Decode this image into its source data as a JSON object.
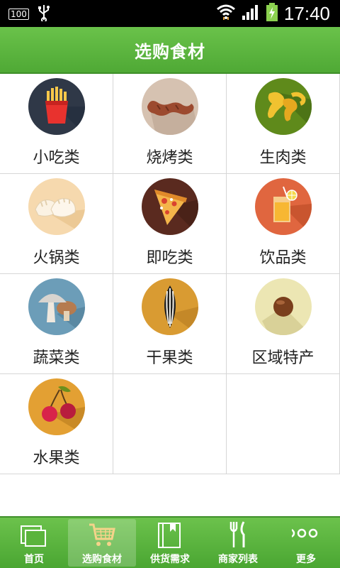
{
  "status_bar": {
    "battery_percent": "100",
    "time": "17:40"
  },
  "header": {
    "title": "选购食材"
  },
  "categories": [
    {
      "label": "小吃类",
      "icon": "french-fries-icon",
      "color": "#2f3847"
    },
    {
      "label": "烧烤类",
      "icon": "sausage-icon",
      "color": "#d6c2b1"
    },
    {
      "label": "生肉类",
      "icon": "chicken-wings-icon",
      "color": "#5f8a1b"
    },
    {
      "label": "火锅类",
      "icon": "dumplings-icon",
      "color": "#f6d9ae"
    },
    {
      "label": "即吃类",
      "icon": "pizza-icon",
      "color": "#5a2a1f"
    },
    {
      "label": "饮品类",
      "icon": "juice-icon",
      "color": "#e0663f"
    },
    {
      "label": "蔬菜类",
      "icon": "mushroom-icon",
      "color": "#6c9db8"
    },
    {
      "label": "干果类",
      "icon": "sunflower-seed-icon",
      "color": "#d99b32"
    },
    {
      "label": "区域特产",
      "icon": "chestnut-icon",
      "color": "#ece6b3"
    },
    {
      "label": "水果类",
      "icon": "cherry-icon",
      "color": "#e3a033"
    }
  ],
  "nav": {
    "items": [
      {
        "label": "首页",
        "icon": "home-icon"
      },
      {
        "label": "选购食材",
        "icon": "cart-icon",
        "active": true
      },
      {
        "label": "供货需求",
        "icon": "book-icon"
      },
      {
        "label": "商家列表",
        "icon": "fork-knife-icon"
      },
      {
        "label": "更多",
        "icon": "more-icon"
      }
    ]
  }
}
